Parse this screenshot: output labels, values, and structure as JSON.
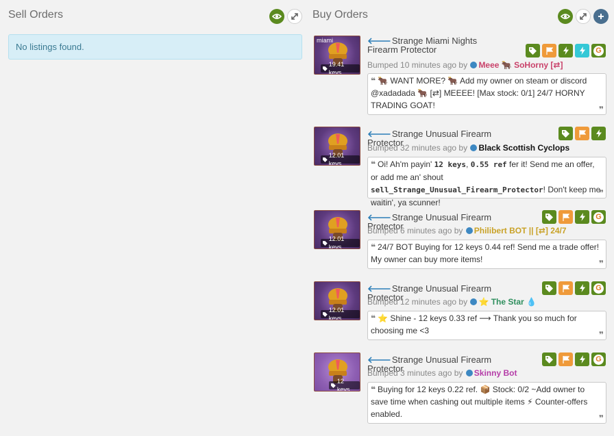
{
  "sell": {
    "title": "Sell Orders",
    "empty_message": "No listings found."
  },
  "buy": {
    "title": "Buy Orders",
    "listings": [
      {
        "quality": "miami",
        "price": "19.41 keys",
        "title": "Strange Miami Nights Firearm Protector",
        "bumped": "Bumped 10 minutes ago by",
        "user": "Meee 🐂 SoHorny [⇄]",
        "user_color": "#c9426a",
        "message": "🐂 WANT MORE? 🐂 Add my owner on steam or discord @xadadada 🐂 [⇄] MEEEE! [Max stock: 0/1] 24/7 HORNY TRADING GOAT!"
      },
      {
        "quality": "",
        "price": "12.01 keys",
        "title": "Strange Unusual Firearm Protector",
        "bumped": "Bumped 32 minutes ago by",
        "user": "Black Scottish Cyclops",
        "user_color": "#111111",
        "message_parts": {
          "a": "Oi! Ah'm payin' ",
          "b": "12 keys",
          "c": ", ",
          "d": "0.55 ref",
          "e": " fer it! Send me an offer, or add me an' shout ",
          "f": "sell_Strange_Unusual_Firearm_Protector",
          "g": "! Don't keep me waitin', ya scunner!"
        }
      },
      {
        "quality": "",
        "price": "12.01 keys",
        "title": "Strange Unusual Firearm Protector",
        "bumped": "Bumped 6 minutes ago by",
        "user": "Philibert BOT || [⇄] 24/7",
        "user_color": "#c9a227",
        "message": "24/7 BOT Buying for 12 keys 0.44 ref! Send me a trade offer! My owner can buy more items!"
      },
      {
        "quality": "",
        "price": "12.01 keys",
        "title": "Strange Unusual Firearm Protector",
        "bumped": "Bumped 12 minutes ago by",
        "user": "⭐ The Star 💧",
        "user_color": "#2f8f5e",
        "message": "⭐ Shine - 12 keys 0.33 ref ⟶ Thank you so much for choosing me <3"
      },
      {
        "quality": "",
        "price": "12 keys",
        "title": "Strange Unusual Firearm Protector",
        "bumped": "Bumped 3 minutes ago by",
        "user": "Skinny Bot",
        "user_color": "#b53da8",
        "message": "Buying for 12 keys 0.22 ref. 📦 Stock: 0/2 ~Add owner to save time when cashing out multiple items ⚡ Counter-offers enabled."
      }
    ]
  },
  "colors": {
    "accent_green": "#5b8a1f",
    "accent_orange": "#ef9a3a",
    "accent_cyan": "#35c8d6",
    "info_bg": "#d7eef7",
    "link_blue": "#2d7fb8"
  }
}
